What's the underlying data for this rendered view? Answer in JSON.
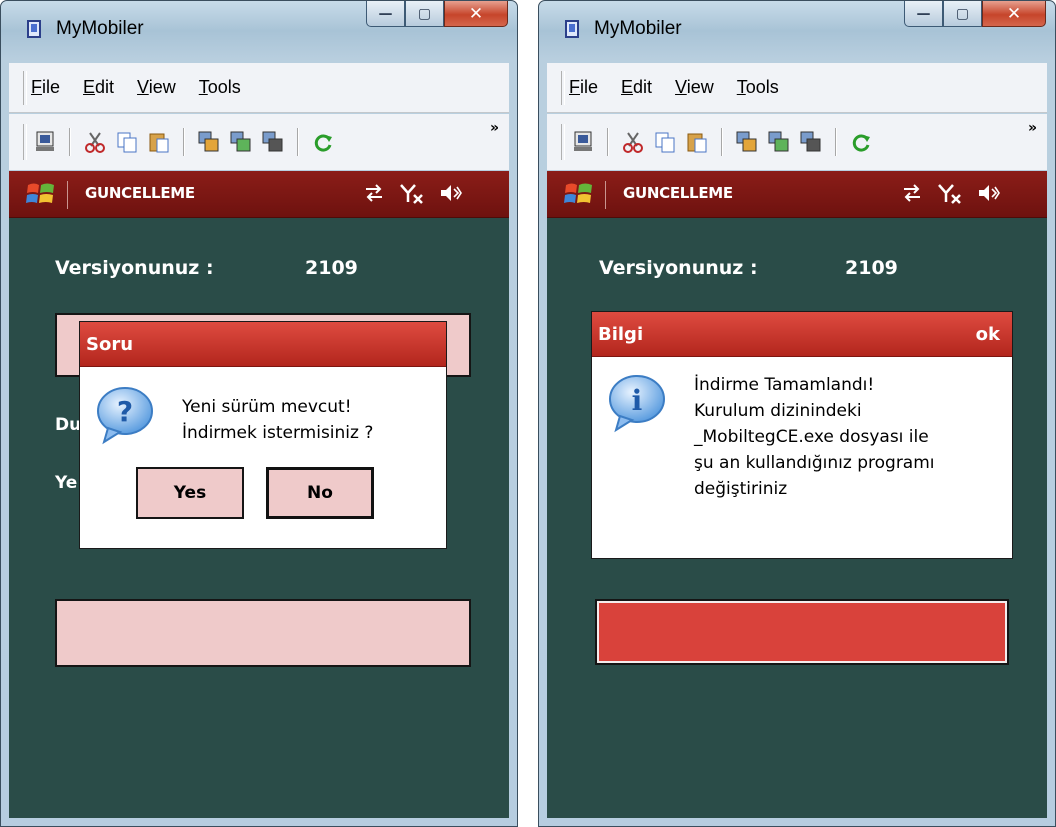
{
  "left_window": {
    "title": "MyMobiler",
    "menu": [
      "File",
      "Edit",
      "View",
      "Tools"
    ],
    "app_title": "GUNCELLEME",
    "version_label": "Versiyonunuz :",
    "version_value": "2109",
    "obscured_label_1": "Du",
    "obscured_label_2": "Ye",
    "dialog": {
      "title": "Soru",
      "message": "Yeni sürüm mevcut!\nİndirmek istermisiniz ?",
      "yes_label": "Yes",
      "no_label": "No",
      "icon": "question-icon"
    }
  },
  "right_window": {
    "title": "MyMobiler",
    "menu": [
      "File",
      "Edit",
      "View",
      "Tools"
    ],
    "app_title": "GUNCELLEME",
    "version_label": "Versiyonunuz :",
    "version_value": "2109",
    "dialog": {
      "title": "Bilgi",
      "ok_label": "ok",
      "message": "İndirme Tamamlandı!\nKurulum dizinindeki\n_MobiltegCE.exe dosyası ile\nşu an kullandığınız programı\ndeğiştiriniz",
      "icon": "info-icon"
    }
  },
  "caption_buttons": {
    "minimize": "minimize-icon",
    "maximize": "maximize-icon",
    "close": "close-icon"
  },
  "toolbar_overflow": "»",
  "colors": {
    "device_bg": "#2a4c48",
    "header_red": "#8b1d18",
    "dialog_red": "#c9342b",
    "button_pink": "#efcaca",
    "progress_red": "#d9423b"
  }
}
